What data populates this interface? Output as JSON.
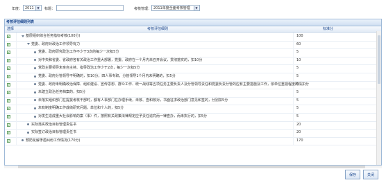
{
  "filter": {
    "year_label": "年度：",
    "year_value": "2011",
    "title_label": "标题：",
    "title_value": "",
    "org_label": "考核管理：",
    "org_value": "2011年度全面考核管理"
  },
  "panel": {
    "title": "考核评估细则列表",
    "columns": [
      "选择",
      "考核评估细则",
      "标准分"
    ]
  },
  "rows": [
    {
      "text": "基层组织综合任务指标考核(100分)",
      "score": "100",
      "indent": 0,
      "bullet": "expand"
    },
    {
      "text": "党委、政府对政治工作领导有力",
      "score": "60",
      "indent": 1,
      "bullet": "expand"
    },
    {
      "text": "党委、政府研究政治工作不少于3次的每少一次扣5分",
      "score": "5",
      "indent": 2,
      "bullet": "dot"
    },
    {
      "text": "对中央和省委、省政府各有关政治工作重大部署，党委、政府在一个月内未召开会议，贯彻落实的，扣10分",
      "score": "10",
      "indent": 2,
      "bullet": "dot"
    },
    {
      "text": "党政主要领导未亲自主持、指导政治工作少于2次，每少一次扣5分",
      "score": "5",
      "indent": 2,
      "bullet": "dot"
    },
    {
      "text": "党委、政府分管领导不明确的，扣10分；四人事专职，分管领导1个月内未明确的，扣5分",
      "score": "5",
      "indent": 2,
      "bullet": "dot"
    },
    {
      "text": "党委、政府未明确政治保障、组织建设、宣传思想、群众工作、统一战线等五项任务主要负责人及分管领导责任和党委负责分管的应有主要措施及工作，依单位重视程度酌情扣分",
      "score": "5",
      "indent": 2,
      "bullet": "dot"
    },
    {
      "text": "未建立政治任务档案的，扣5分",
      "score": "5",
      "indent": 2,
      "bullet": "dot"
    },
    {
      "text": "未落实组织部门在提拔考核干部时，都有人事部门在办理手续，未核、查和核对，书面征求政治部门意见和签的，分别扣5分",
      "score": "5",
      "indent": 2,
      "bullet": "dot"
    },
    {
      "text": "未有制度明确工作成绩研究问题，单位和个人的，扣5分",
      "score": "5",
      "indent": 2,
      "bullet": "dot"
    },
    {
      "text": "对发生造成重大社会影响的案（事）件，按照有关政策法律规定应予责任追究而一律查办，而未执行的，扣5分",
      "score": "5",
      "indent": 2,
      "bullet": "dot"
    },
    {
      "text": "实际落实政治目标管理责任书",
      "score": "20",
      "indent": 1,
      "bullet": "dot"
    },
    {
      "text": "实际签订政治目标管理责任书",
      "score": "20",
      "indent": 1,
      "bullet": "dot"
    },
    {
      "text": "预防化解矛盾纠纷工作情况(170分)",
      "score": "170",
      "indent": 0,
      "bullet": "dot"
    }
  ],
  "buttons": {
    "save": "保存",
    "close": "关闭"
  }
}
